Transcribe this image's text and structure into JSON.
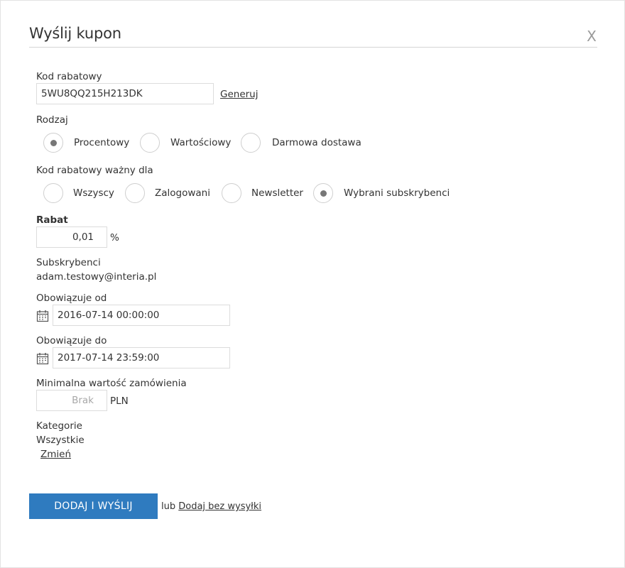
{
  "dialog": {
    "title": "Wyślij kupon",
    "close_label": "X"
  },
  "code": {
    "label": "Kod rabatowy",
    "value": "5WU8QQ215H213DK",
    "generate_label": "Generuj"
  },
  "type": {
    "label": "Rodzaj",
    "options": [
      {
        "label": "Procentowy",
        "checked": true
      },
      {
        "label": "Wartościowy",
        "checked": false
      },
      {
        "label": "Darmowa dostawa",
        "checked": false
      }
    ]
  },
  "valid_for": {
    "label": "Kod rabatowy ważny dla",
    "options": [
      {
        "label": "Wszyscy",
        "checked": false
      },
      {
        "label": "Zalogowani",
        "checked": false
      },
      {
        "label": "Newsletter",
        "checked": false
      },
      {
        "label": "Wybrani subskrybenci",
        "checked": true
      }
    ]
  },
  "discount": {
    "label": "Rabat",
    "value": "0,01",
    "unit": "%"
  },
  "subscribers": {
    "label": "Subskrybenci",
    "value": "adam.testowy@interia.pl"
  },
  "valid_from": {
    "label": "Obowiązuje od",
    "value": "2016-07-14 00:00:00"
  },
  "valid_to": {
    "label": "Obowiązuje do",
    "value": "2017-07-14 23:59:00"
  },
  "min_order": {
    "label": "Minimalna wartość zamówienia",
    "placeholder": "Brak",
    "unit": "PLN"
  },
  "categories": {
    "label": "Kategorie",
    "value": "Wszystkie",
    "change_label": "Zmień"
  },
  "actions": {
    "submit_label": "DODAJ I WYŚLIJ",
    "or_label": "lub",
    "add_without_send_label": "Dodaj bez wysyłki"
  },
  "colors": {
    "primary": "#2f7bbf",
    "border": "#dcdcdc"
  }
}
